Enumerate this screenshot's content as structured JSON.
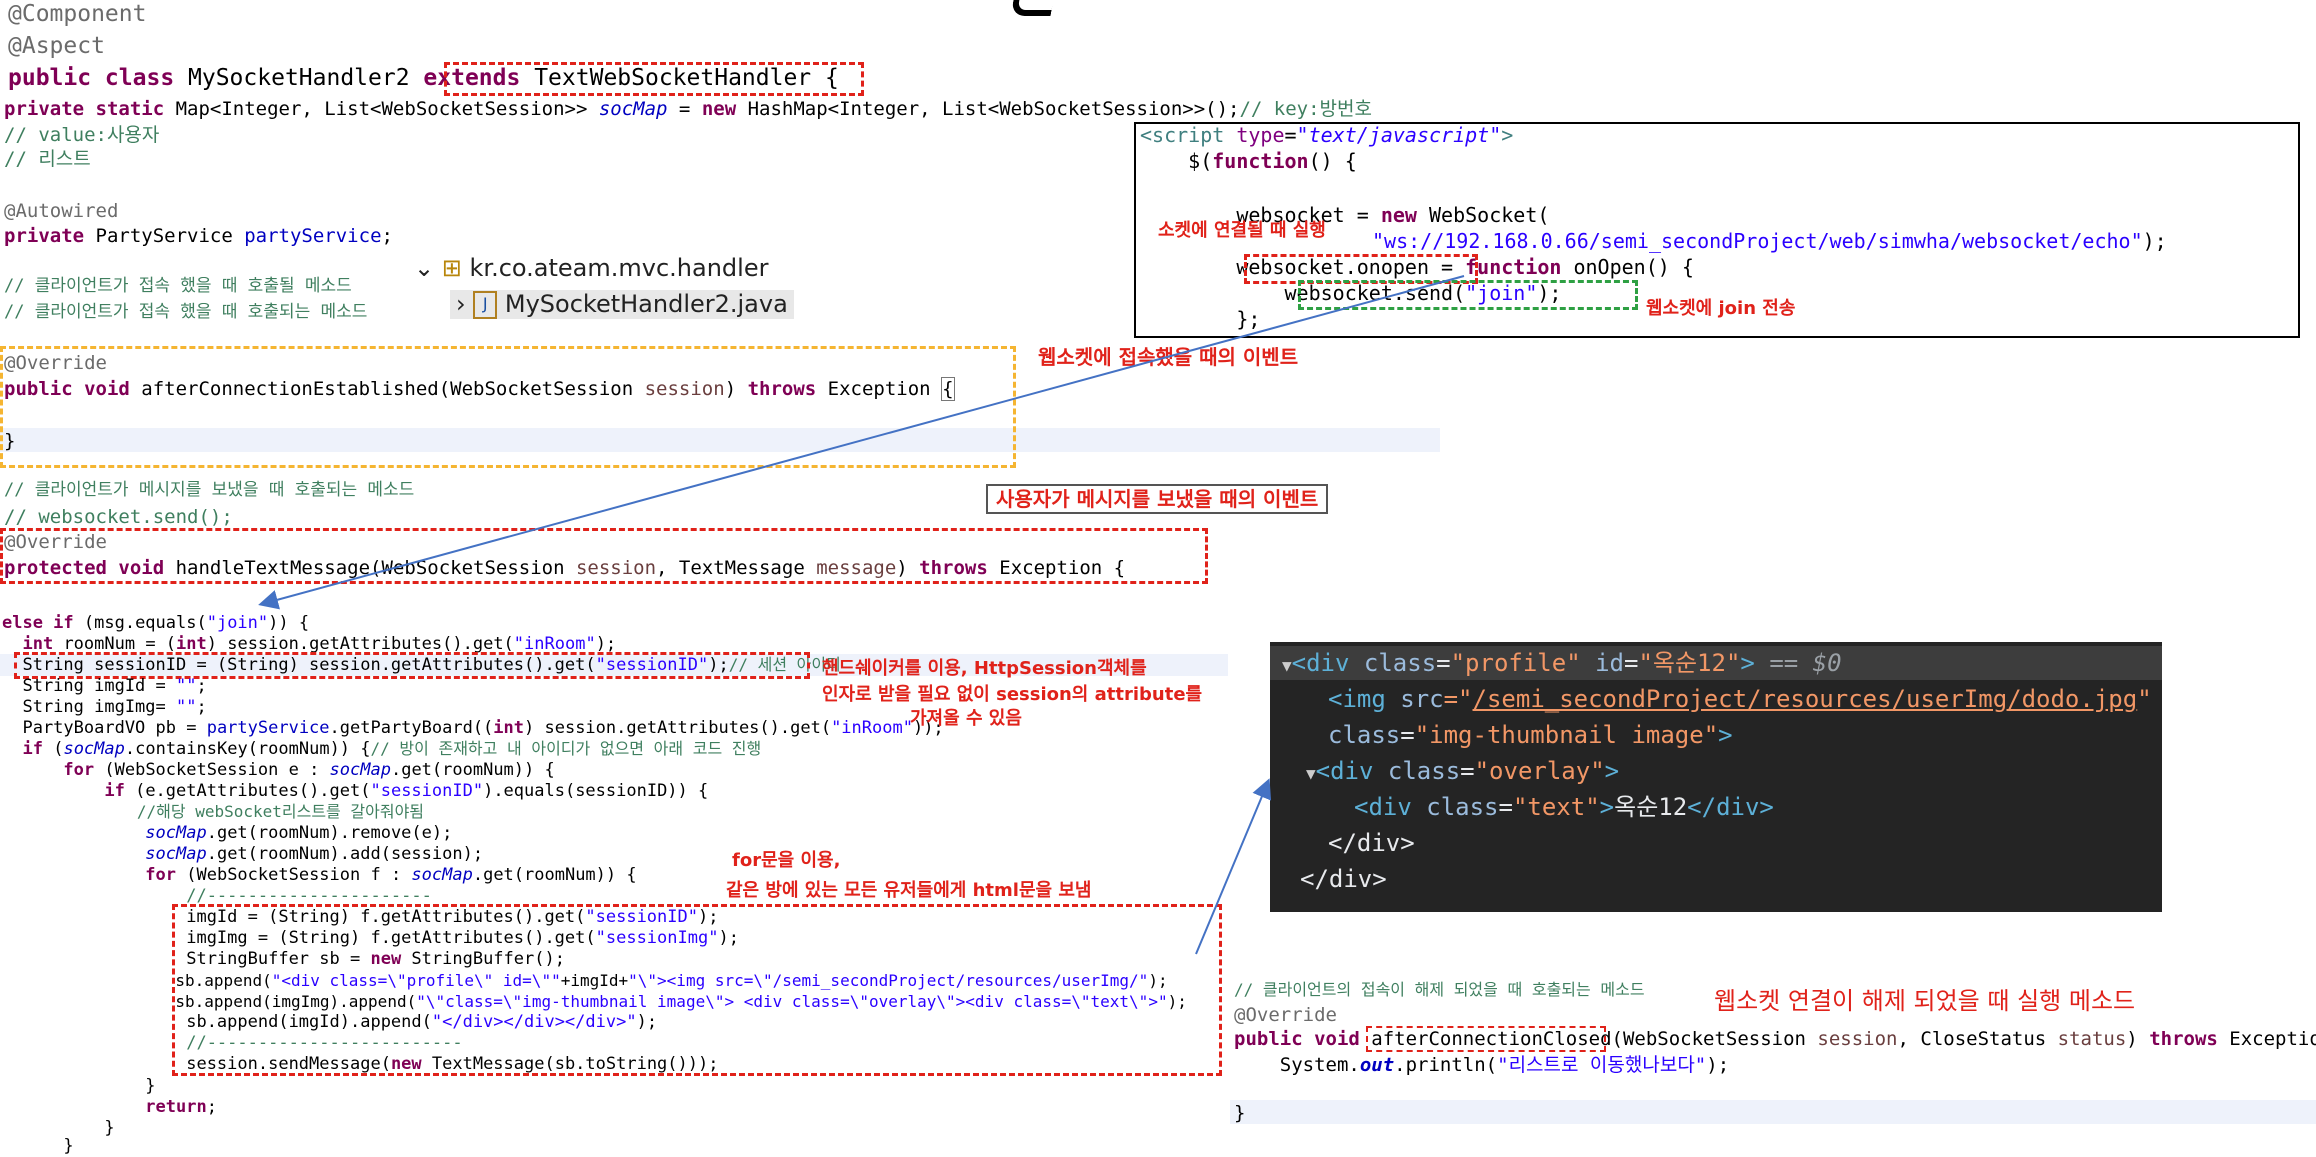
{
  "top": {
    "ann_component": "@Component",
    "ann_aspect": "@Aspect",
    "class_pre": "public class",
    "class_name": " MySocketHandler2 ",
    "extends_kw": "extends",
    "extends_name": " TextWebSocketHandler",
    "brace": " {",
    "field_mod": "private static",
    "field_type": " Map<Integer, List<WebSocketSession>> ",
    "field_name": "socMap",
    "field_eq": " = ",
    "field_new": "new",
    "field_init": " HashMap<Integer, List<WebSocketSession>>();",
    "field_comment": "// key:방번호",
    "c_value": "// value:사용자",
    "c_list": "// 리스트",
    "autowired": "@Autowired",
    "svc_mod": "private",
    "svc_type": " PartyService ",
    "svc_name": "partyService",
    "svc_end": ";",
    "c_connect1": "// 클라이언트가 접속 했을 때 호출될 메소드",
    "c_connect2": "// 클라이언트가 접속 했을 때 호출되는 메소드"
  },
  "tree": {
    "package": "kr.co.ateam.mvc.handler",
    "file": "MySocketHandler2.java"
  },
  "established": {
    "override": "@Override",
    "sig_kw": "public void",
    "sig_name": " afterConnectionEstablished(WebSocketSession ",
    "sig_param": "session",
    "sig_close": ") ",
    "sig_throws": "throws",
    "sig_exc": " Exception ",
    "sig_brace": "{",
    "close": "}"
  },
  "message": {
    "c1": "// 클라이언트가 메시지를 보냈을 때 호출되는 메소드",
    "c2": "// websocket.send();",
    "override": "@Override",
    "sig_kw": "protected void",
    "sig_name": " handleTextMessage(WebSocketSession ",
    "sig_p1": "session",
    "sig_mid": ", TextMessage ",
    "sig_p2": "message",
    "sig_close": ") ",
    "sig_throws": "throws",
    "sig_exc": " Exception {"
  },
  "body": {
    "l1_kw": "else if",
    "l1_a": " (msg.equals(",
    "l1_s": "\"join\"",
    "l1_b": ")) {",
    "l2_a": "  ",
    "l2_kw": "int",
    "l2_b": " roomNum = (",
    "l2_kw2": "int",
    "l2_c": ") session.getAttributes().get(",
    "l2_s": "\"inRoom\"",
    "l2_d": ");",
    "l3_a": "  String sessionID = (String) session.getAttributes().get(",
    "l3_s": "\"sessionID\"",
    "l3_b": ");",
    "l3_c": "// 세션 아이디",
    "l4_a": "  String imgId = ",
    "l4_s": "\"\"",
    "l4_b": ";",
    "l5_a": "  String imgImg= ",
    "l5_s": "\"\"",
    "l5_b": ";",
    "l6_a": "  PartyBoardVO pb = ",
    "l6_f": "partyService",
    "l6_b": ".getPartyBoard((",
    "l6_kw": "int",
    "l6_c": ") session.getAttributes().get(",
    "l6_s": "\"inRoom\"",
    "l6_d": "));",
    "l7_a": "  ",
    "l7_kw": "if",
    "l7_b": " (",
    "l7_f": "socMap",
    "l7_c": ".containsKey(roomNum)) {",
    "l7_cm": "// 방이 존재하고 내 아이디가 없으면 아래 코드 진행",
    "l8_a": "      ",
    "l8_kw": "for",
    "l8_b": " (WebSocketSession e : ",
    "l8_f": "socMap",
    "l8_c": ".get(roomNum)) {",
    "l9_a": "          ",
    "l9_kw": "if",
    "l9_b": " (e.getAttributes().get(",
    "l9_s": "\"sessionID\"",
    "l9_c": ").equals(sessionID)) {",
    "l10": "              //해당 webSocket리스트를 갈아줘야됨",
    "l11_a": "              ",
    "l11_f": "socMap",
    "l11_b": ".get(roomNum).remove(e);",
    "l12_a": "              ",
    "l12_f": "socMap",
    "l12_b": ".get(roomNum).add(session);",
    "l13_a": "              ",
    "l13_kw": "for",
    "l13_b": " (WebSocketSession f : ",
    "l13_f": "socMap",
    "l13_c": ".get(roomNum)) {",
    "l14": "                  //----------------------",
    "l15_a": "                  imgId = (String) f.getAttributes().get(",
    "l15_s": "\"sessionID\"",
    "l15_b": ");",
    "l16_a": "                  imgImg = (String) f.getAttributes().get(",
    "l16_s": "\"sessionImg\"",
    "l16_b": ");",
    "l17_a": "                  StringBuffer sb = ",
    "l17_kw": "new",
    "l17_b": " StringBuffer();",
    "l18_a": "                  sb.append(",
    "l18_s": "\"<div class=\\\"profile\\\" id=\\\"\"",
    "l18_b": "+imgId+",
    "l18_s2": "\"\\\"><img src=\\\"/semi_secondProject/resources/userImg/\"",
    "l18_c": ");",
    "l19_a": "                  sb.append(imgImg).append(",
    "l19_s": "\"\\\"class=\\\"img-thumbnail image\\\"> <div class=\\\"overlay\\\"><div class=\\\"text\\\">\"",
    "l19_b": ");",
    "l20_a": "                  sb.append(imgId).append(",
    "l20_s": "\"</div></div></div>\"",
    "l20_b": ");",
    "l21": "                  //-------------------------",
    "l22_a": "                  session.sendMessage(",
    "l22_kw": "new",
    "l22_b": " TextMessage(sb.toString()));",
    "l23": "              }",
    "l24_a": "              ",
    "l24_kw": "return",
    "l24_b": ";",
    "l25": "          }",
    "l26": "      }"
  },
  "script": {
    "open_a": "<script ",
    "open_attr": "type",
    "open_eq": "=",
    "open_val": "\"text/javascript\"",
    "open_b": ">",
    "l1_a": "    $(",
    "l1_kw": "function",
    "l1_b": "() {",
    "l2_a": "        websocket = ",
    "l2_kw": "new",
    "l2_b": " WebSocket(",
    "l3_s": "\"ws://192.168.0.66/semi_secondProject/web/simwha/websocket/echo\"",
    "l3_b": ");",
    "l4_a": "        websocket.onopen = ",
    "l4_kw": "function",
    "l4_b": " onOpen() {",
    "l5_a": "            websocket.send(",
    "l5_s": "\"join\"",
    "l5_b": ");",
    "l6": "        };"
  },
  "devtools": {
    "r1_tri": "▼",
    "r1_a": "<div ",
    "r1_attr": "class",
    "r1_eq": "=",
    "r1_val": "\"profile\"",
    "r1_sp": " ",
    "r1_attr2": "id",
    "r1_eq2": "=",
    "r1_val2": "\"옥순12\"",
    "r1_b": ">",
    "r1_c": " == $0",
    "r2_a": "<img ",
    "r2_attr": "src",
    "r2_eq": "=\"",
    "r2_link": "/semi_secondProject/resources/userImg/dodo.jpg",
    "r2_q": "\"",
    "r3_attr": "class",
    "r3_eq": "=",
    "r3_val": "\"img-thumbnail image\"",
    "r3_b": ">",
    "r4_tri": "▼",
    "r4_a": "<div ",
    "r4_attr": "class",
    "r4_eq": "=",
    "r4_val": "\"overlay\"",
    "r4_b": ">",
    "r5_a": "<div ",
    "r5_attr": "class",
    "r5_eq": "=",
    "r5_val": "\"text\"",
    "r5_b": ">",
    "r5_txt": "옥순12",
    "r5_c": "</div>",
    "r6": "</div>",
    "r7": "</div>"
  },
  "closed": {
    "c1": "// 클라이언트의 접속이 해제 되었을 때 호출되는 메소드",
    "override": "@Override",
    "sig_kw": "public void",
    "sig_sp": " ",
    "sig_name": "afterConnectionClosed",
    "sig_a": "(WebSocketSession ",
    "sig_p1": "session",
    "sig_b": ", CloseStatus ",
    "sig_p2": "status",
    "sig_c": ") ",
    "sig_throws": "throws",
    "sig_exc": " Exception ",
    "sig_brace": "{",
    "l1_a": "    System.",
    "l1_f": "out",
    "l1_b": ".println(",
    "l1_s": "\"리스트로 이동했나보다\"",
    "l1_c": ");",
    "close": "}"
  },
  "notes": {
    "connect_fire": "소켓에 연결될 때 실행",
    "join_send": "웹소켓에 join 전송",
    "connected_event": "웹소켓에 접속했을 때의 이벤트",
    "message_event": "사용자가 메시지를 보냈을 때의 이벤트",
    "handshake1": "핸드쉐이커를 이용, HttpSession객체를",
    "handshake2": "인자로 받을 필요 없이 session의 attribute를",
    "handshake3": "가져올 수 있음",
    "for1": "for문을 이용,",
    "for2": "같은 방에 있는 모든 유저들에게 html문을 보냄",
    "closed_method": "웹소켓 연결이 해제 되었을 때 실행 메소드"
  }
}
